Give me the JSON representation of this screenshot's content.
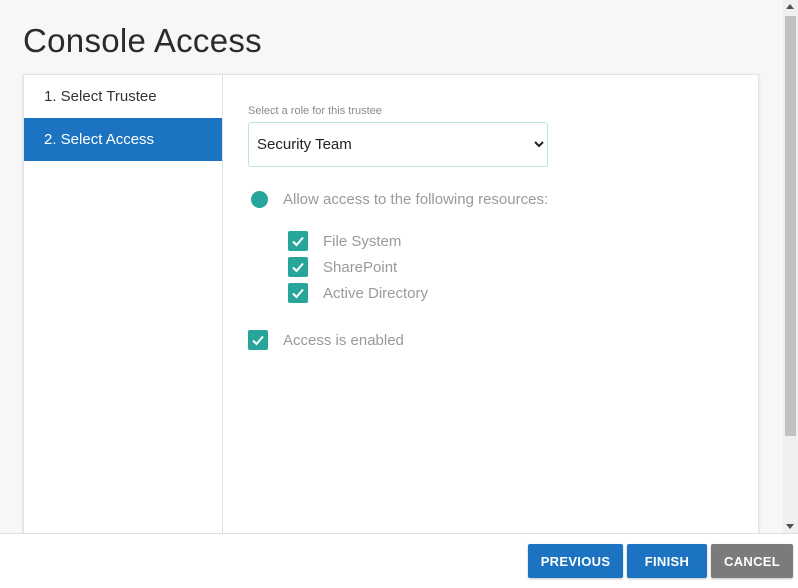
{
  "page": {
    "title": "Console Access"
  },
  "steps": [
    {
      "label": "1. Select Trustee",
      "active": false
    },
    {
      "label": "2. Select Access",
      "active": true
    }
  ],
  "role": {
    "label": "Select a role for this trustee",
    "selected": "Security Team"
  },
  "access": {
    "radio_label": "Allow access to the following resources:",
    "resources": [
      {
        "label": "File System",
        "checked": true
      },
      {
        "label": "SharePoint",
        "checked": true
      },
      {
        "label": "Active Directory",
        "checked": true
      }
    ],
    "enabled_label": "Access is enabled",
    "enabled": true
  },
  "footer": {
    "previous_label": "PREVIOUS",
    "finish_label": "FINISH",
    "cancel_label": "CANCEL"
  },
  "colors": {
    "primary": "#1c73c1",
    "accent": "#26a69a",
    "cancel": "#7b7b7b"
  }
}
